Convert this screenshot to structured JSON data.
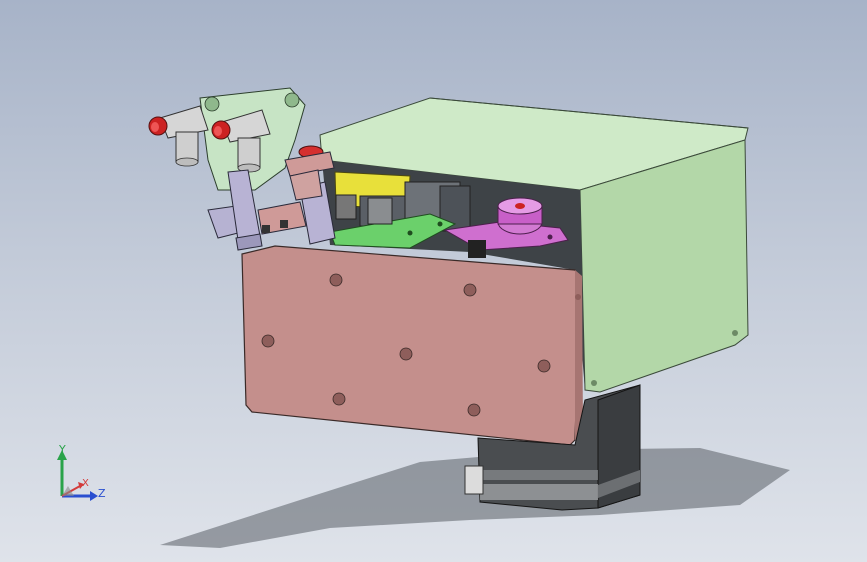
{
  "viewport": {
    "background_top": "#a7b3c8",
    "background_bottom": "#dfe3ea"
  },
  "model": {
    "parts": [
      {
        "name": "housing-cover",
        "color": "#b8dfb0"
      },
      {
        "name": "mounting-plate",
        "color": "#c9908e"
      },
      {
        "name": "stepper-motor",
        "color": "#4a4a4a"
      },
      {
        "name": "pneumatic-bracket",
        "color": "#c7e4c5"
      },
      {
        "name": "air-fittings",
        "color": "#d8d8d8"
      },
      {
        "name": "cam-disc",
        "color": "#cc66cc"
      },
      {
        "name": "gripper-jaws",
        "color": "#b6b2d2"
      },
      {
        "name": "slider-plate",
        "color": "#66cc66"
      },
      {
        "name": "yellow-block",
        "color": "#e8e03a"
      }
    ]
  },
  "triad": {
    "y_label": "Y",
    "x_label": "X",
    "z_label": "Z",
    "y_color": "#2aa34a",
    "x_color": "#d33b3b",
    "z_color": "#2a4fd0"
  }
}
